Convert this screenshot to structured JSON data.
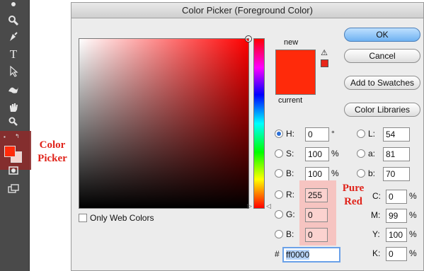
{
  "dialog": {
    "title": "Color Picker (Foreground Color)",
    "new_label": "new",
    "current_label": "current",
    "new_color": "#ff2a0a",
    "current_color": "#ff2a0a",
    "gamut_warning_glyph": "⚠",
    "buttons": {
      "ok": "OK",
      "cancel": "Cancel",
      "add_to_swatches": "Add to Swatches",
      "color_libraries": "Color Libraries"
    },
    "hsb": {
      "h_label": "H:",
      "h_value": "0",
      "h_unit": "°",
      "s_label": "S:",
      "s_value": "100",
      "s_unit": "%",
      "b_label": "B:",
      "b_value": "100",
      "b_unit": "%"
    },
    "rgb": {
      "r_label": "R:",
      "r_value": "255",
      "g_label": "G:",
      "g_value": "0",
      "b_label": "B:",
      "b_value": "0"
    },
    "lab": {
      "l_label": "L:",
      "l_value": "54",
      "a_label": "a:",
      "a_value": "81",
      "b_label": "b:",
      "b_value": "70"
    },
    "cmyk": {
      "c_label": "C:",
      "c_value": "0",
      "c_unit": "%",
      "m_label": "M:",
      "m_value": "99",
      "m_unit": "%",
      "y_label": "Y:",
      "y_value": "100",
      "y_unit": "%",
      "k_label": "K:",
      "k_value": "0",
      "k_unit": "%"
    },
    "hex_hash": "#",
    "hex_value": "ff0000",
    "only_web_colors_label": "Only Web Colors",
    "selected_mode": "H"
  },
  "toolbar": {
    "tools": [
      "eyedropper-icon",
      "zoom-icon",
      "pen-icon",
      "type-icon",
      "path-select-icon",
      "shape-icon",
      "hand-icon",
      "zoom-icon",
      "quick-mask-icon",
      "screen-mode-icon"
    ],
    "foreground_color": "#ff2a0a",
    "background_color": "#f4d3cf"
  },
  "annotations": {
    "color_picker": "Color Picker",
    "pure_red": "Pure Red"
  }
}
